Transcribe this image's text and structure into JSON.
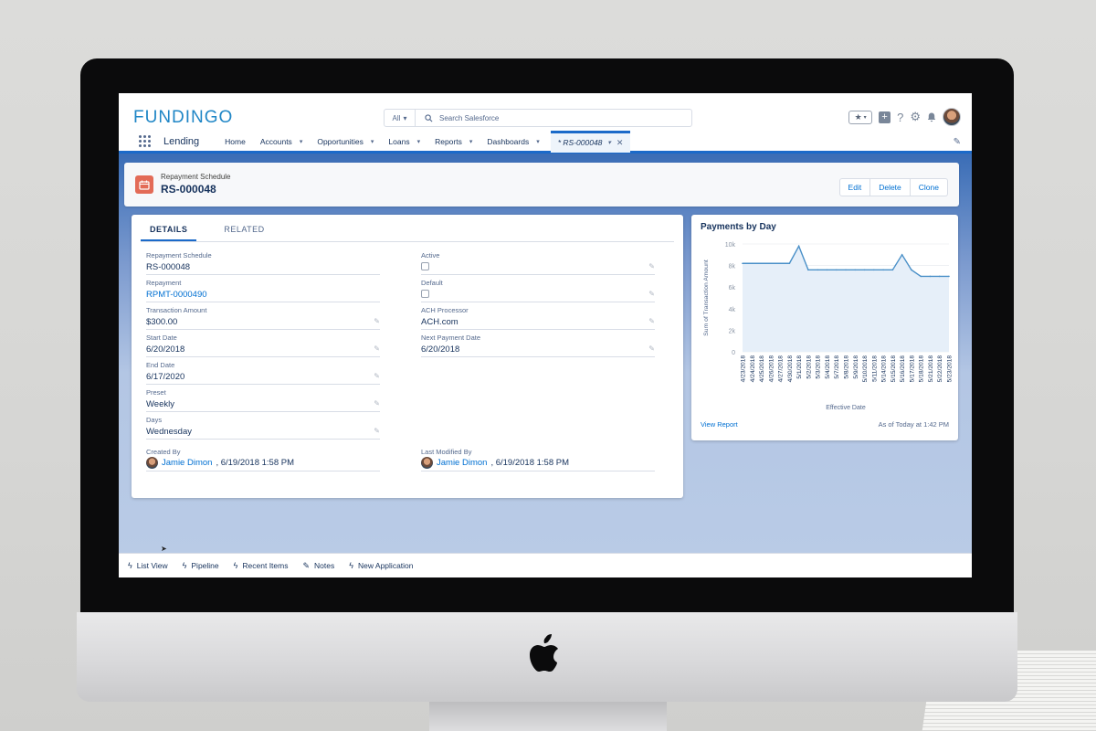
{
  "app": {
    "logo_text": "FUNDINGO",
    "app_name": "Lending"
  },
  "search": {
    "scope": "All",
    "placeholder": "Search Salesforce"
  },
  "nav": {
    "items": [
      {
        "label": "Home",
        "has_chevron": false
      },
      {
        "label": "Accounts",
        "has_chevron": true
      },
      {
        "label": "Opportunities",
        "has_chevron": true
      },
      {
        "label": "Loans",
        "has_chevron": true
      },
      {
        "label": "Reports",
        "has_chevron": true
      },
      {
        "label": "Dashboards",
        "has_chevron": true
      }
    ],
    "active_tab": "* RS-000048"
  },
  "record": {
    "type": "Repayment Schedule",
    "name": "RS-000048",
    "buttons": {
      "edit": "Edit",
      "delete": "Delete",
      "clone": "Clone"
    }
  },
  "tabs": {
    "details": "DETAILS",
    "related": "RELATED"
  },
  "fields": {
    "repayment_schedule": {
      "label": "Repayment Schedule",
      "value": "RS-000048"
    },
    "repayment": {
      "label": "Repayment",
      "value": "RPMT-0000490"
    },
    "transaction_amount": {
      "label": "Transaction Amount",
      "value": "$300.00"
    },
    "start_date": {
      "label": "Start Date",
      "value": "6/20/2018"
    },
    "end_date": {
      "label": "End Date",
      "value": "6/17/2020"
    },
    "preset": {
      "label": "Preset",
      "value": "Weekly"
    },
    "days": {
      "label": "Days",
      "value": "Wednesday"
    },
    "active": {
      "label": "Active",
      "checked": false
    },
    "default": {
      "label": "Default",
      "checked": false
    },
    "ach_processor": {
      "label": "ACH Processor",
      "value": "ACH.com"
    },
    "next_payment_date": {
      "label": "Next Payment Date",
      "value": "6/20/2018"
    },
    "created_by": {
      "label": "Created By",
      "user": "Jamie Dimon",
      "date": ", 6/19/2018 1:58 PM"
    },
    "last_modified_by": {
      "label": "Last Modified By",
      "user": "Jamie Dimon",
      "date": ", 6/19/2018 1:58 PM"
    }
  },
  "chart_card": {
    "title": "Payments by Day",
    "view_report": "View Report",
    "as_of": "As of Today at 1:42 PM"
  },
  "chart_data": {
    "type": "area",
    "title": "Payments by Day",
    "xlabel": "Effective Date",
    "ylabel": "Sum of Transaction Amount",
    "ylim": [
      0,
      10000
    ],
    "yticks": [
      "0",
      "2k",
      "4k",
      "6k",
      "8k",
      "10k"
    ],
    "categories": [
      "4/23/2018",
      "4/24/2018",
      "4/25/2018",
      "4/26/2018",
      "4/27/2018",
      "4/30/2018",
      "5/1/2018",
      "5/2/2018",
      "5/3/2018",
      "5/4/2018",
      "5/7/2018",
      "5/8/2018",
      "5/9/2018",
      "5/10/2018",
      "5/11/2018",
      "5/14/2018",
      "5/15/2018",
      "5/16/2018",
      "5/17/2018",
      "5/18/2018",
      "5/21/2018",
      "5/22/2018",
      "5/23/2018"
    ],
    "values": [
      8200,
      8200,
      8200,
      8200,
      8200,
      8200,
      9800,
      7600,
      7600,
      7600,
      7600,
      7600,
      7600,
      7600,
      7600,
      7600,
      7600,
      9000,
      7600,
      7000,
      7000,
      7000,
      7000
    ],
    "color": "#4a90c8",
    "fill": "#e6eff9",
    "grid": true
  },
  "utility_bar": {
    "items": [
      {
        "icon": "bolt-icon",
        "label": "List View"
      },
      {
        "icon": "bolt-icon",
        "label": "Pipeline"
      },
      {
        "icon": "bolt-icon",
        "label": "Recent Items"
      },
      {
        "icon": "note-icon",
        "label": "Notes"
      },
      {
        "icon": "bolt-icon",
        "label": "New Application"
      }
    ]
  },
  "colors": {
    "brand_blue": "#1b6ac9",
    "link": "#0070d2",
    "record_icon": "#e36b57",
    "logo_blue": "#1f86c6",
    "logo_green": "#63a530"
  }
}
